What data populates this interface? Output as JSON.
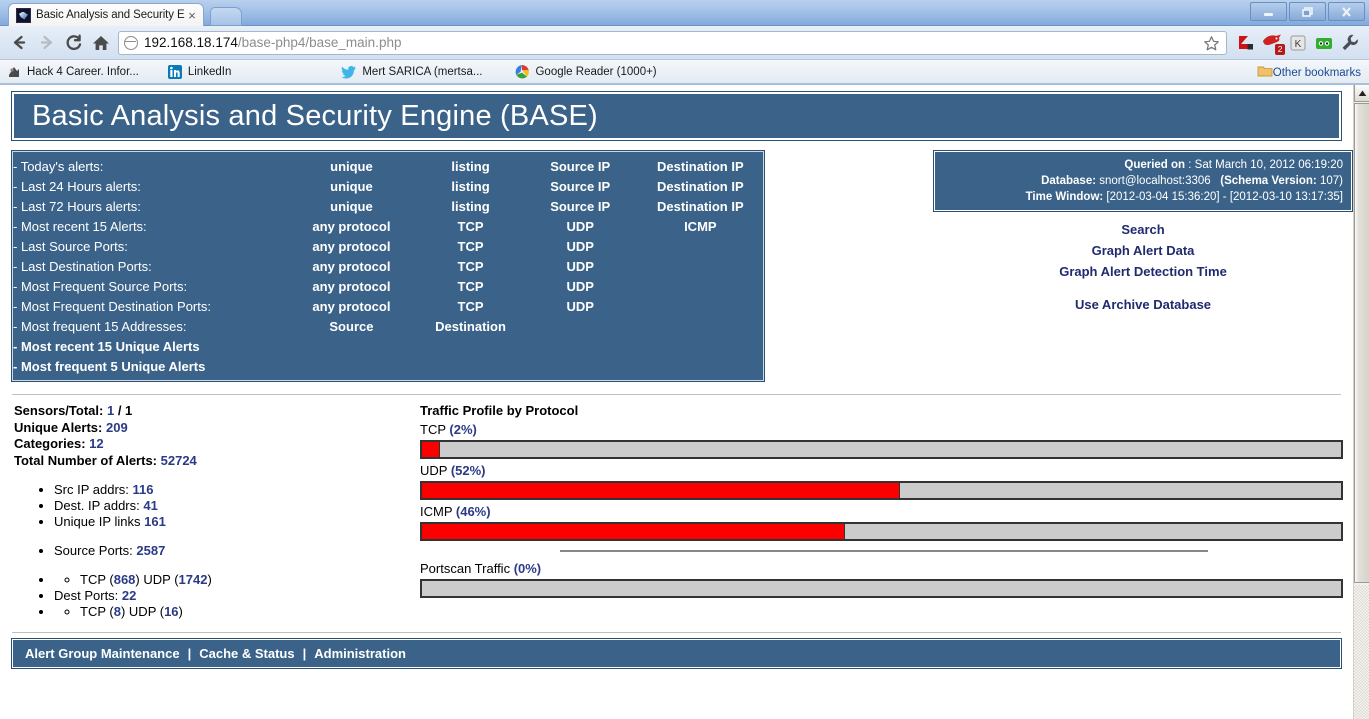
{
  "browser": {
    "tab_title": "Basic Analysis and Security En",
    "tab_close_label": "×",
    "url_host": "192.168.18.174",
    "url_path": "/base-php4/base_main.php",
    "minimize_label": "–",
    "restore_label": "❐",
    "close_label": "✕",
    "bookmarks": [
      {
        "label": "Hack 4 Career. Infor...",
        "icon": "hack4career-icon"
      },
      {
        "label": "LinkedIn",
        "icon": "linkedin-icon"
      },
      {
        "label": "Mert SARICA (mertsa...",
        "icon": "twitter-icon"
      },
      {
        "label": "Google Reader (1000+)",
        "icon": "google-reader-icon"
      }
    ],
    "other_bookmarks": "Other bookmarks",
    "extensions": [
      {
        "name": "kaspersky-icon"
      },
      {
        "name": "adblock-bird-icon",
        "badge": "2"
      },
      {
        "name": "keyboard-k-icon"
      },
      {
        "name": "robot-green-icon"
      },
      {
        "name": "wrench-menu-icon"
      }
    ]
  },
  "page": {
    "banner_title": "Basic Analysis and Security Engine (BASE)",
    "menu_rows": [
      {
        "label": "- Today's alerts:",
        "bold": false,
        "links": [
          "unique",
          "listing",
          "Source IP",
          "Destination IP"
        ]
      },
      {
        "label": "- Last 24 Hours alerts:",
        "bold": false,
        "links": [
          "unique",
          "listing",
          "Source IP",
          "Destination IP"
        ]
      },
      {
        "label": "- Last 72 Hours alerts:",
        "bold": false,
        "links": [
          "unique",
          "listing",
          "Source IP",
          "Destination IP"
        ]
      },
      {
        "label": "- Most recent 15 Alerts:",
        "bold": false,
        "links": [
          "any protocol",
          "TCP",
          "UDP",
          "ICMP"
        ]
      },
      {
        "label": "- Last Source Ports:",
        "bold": false,
        "links": [
          "any protocol",
          "TCP",
          "UDP",
          ""
        ]
      },
      {
        "label": "- Last Destination Ports:",
        "bold": false,
        "links": [
          "any protocol",
          "TCP",
          "UDP",
          ""
        ]
      },
      {
        "label": "- Most Frequent Source Ports:",
        "bold": false,
        "links": [
          "any protocol",
          "TCP",
          "UDP",
          ""
        ]
      },
      {
        "label": "- Most Frequent Destination Ports:",
        "bold": false,
        "links": [
          "any protocol",
          "TCP",
          "UDP",
          ""
        ]
      },
      {
        "label": "- Most frequent 15 Addresses:",
        "bold": false,
        "links": [
          "Source",
          "Destination",
          "",
          ""
        ]
      },
      {
        "label": "- Most recent 15 Unique Alerts",
        "bold": true,
        "links": [
          "",
          "",
          "",
          ""
        ]
      },
      {
        "label": "- Most frequent 5 Unique Alerts",
        "bold": true,
        "links": [
          "",
          "",
          "",
          ""
        ]
      }
    ],
    "info": {
      "queried_label": "Queried on",
      "queried_value": ": Sat March 10, 2012 06:19:20",
      "database_label": "Database:",
      "database_value": "snort@localhost:3306",
      "schema_label": "(Schema Version:",
      "schema_value": "107)",
      "timewindow_label": "Time Window:",
      "timewindow_value": "[2012-03-04 15:36:20] - [2012-03-10 13:17:35]"
    },
    "right_links": [
      "Search",
      "Graph Alert Data",
      "Graph Alert Detection Time",
      "Use Archive Database"
    ],
    "stats": {
      "sensors_label": "Sensors/Total:",
      "sensors_value": "1",
      "sensors_total": "/ 1",
      "unique_alerts_label": "Unique Alerts:",
      "unique_alerts_value": "209",
      "categories_label": "Categories:",
      "categories_value": "12",
      "total_alerts_label": "Total Number of Alerts:",
      "total_alerts_value": "52724",
      "src_ip_label": "Src IP addrs:",
      "src_ip_value": "116",
      "dest_ip_label": "Dest. IP addrs:",
      "dest_ip_value": "41",
      "unique_links_label": "Unique IP links",
      "unique_links_value": "161",
      "source_ports_label": "Source Ports:",
      "source_ports_value": "2587",
      "source_ports_tcp_label": "TCP (",
      "source_ports_tcp_value": "868",
      "source_ports_tcp_close": ")",
      "source_ports_udp_label": "UDP (",
      "source_ports_udp_value": "1742",
      "source_ports_udp_close": ")",
      "dest_ports_label": "Dest Ports:",
      "dest_ports_value": "22",
      "dest_ports_tcp_label": "TCP (",
      "dest_ports_tcp_value": "8",
      "dest_ports_tcp_close": ")",
      "dest_ports_udp_label": "UDP (",
      "dest_ports_udp_value": "16",
      "dest_ports_udp_close": ")"
    },
    "footer_links": [
      "Alert Group Maintenance",
      "Cache & Status",
      "Administration"
    ],
    "footer_sep": "|"
  },
  "chart_data": {
    "type": "bar",
    "title": "Traffic Profile by Protocol",
    "orientation": "horizontal",
    "categories": [
      "TCP",
      "UDP",
      "ICMP",
      "Portscan Traffic"
    ],
    "values": [
      2,
      52,
      46,
      0
    ],
    "value_labels": [
      "(2%)",
      "(52%)",
      "(46%)",
      "(0%)"
    ],
    "xlabel": "",
    "ylabel": "",
    "xlim": [
      0,
      100
    ],
    "unit": "%",
    "grid": false,
    "legend": "none",
    "bar_color": "#fc0000",
    "track_color": "#cccccc",
    "border_color": "#333333",
    "label_color": "#2b3a86"
  },
  "colors": {
    "base_blue": "#3b6389",
    "link_navy": "#202a6e",
    "value_navy": "#2b3a86",
    "bar_red": "#fc0000",
    "bar_track": "#cccccc"
  }
}
